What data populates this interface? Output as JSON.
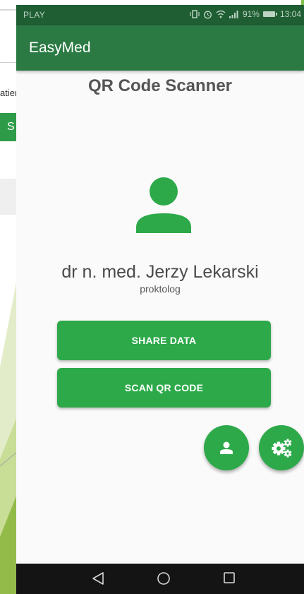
{
  "background_window": {
    "text_fragment": "atien",
    "button_fragment": "S"
  },
  "status_bar": {
    "carrier": "PLAY",
    "battery": "91%",
    "time": "13:04"
  },
  "app_bar": {
    "title": "EasyMed"
  },
  "page": {
    "heading": "QR Code Scanner"
  },
  "doctor": {
    "name": "dr n. med. Jerzy Lekarski",
    "specialty": "proktolog"
  },
  "buttons": {
    "share": "SHARE DATA",
    "scan": "SCAN QR CODE"
  },
  "fabs": {
    "profile_icon": "person-icon",
    "settings_icon": "cogs-icon"
  },
  "nav": {
    "back_icon": "back-triangle-icon",
    "home_icon": "home-circle-icon",
    "recents_icon": "recents-square-icon"
  },
  "colors": {
    "status_bar": "#1f5e33",
    "app_bar": "#2b7a43",
    "accent_green": "#2da94a",
    "nav_bar": "#141414",
    "background": "#fafafa"
  }
}
